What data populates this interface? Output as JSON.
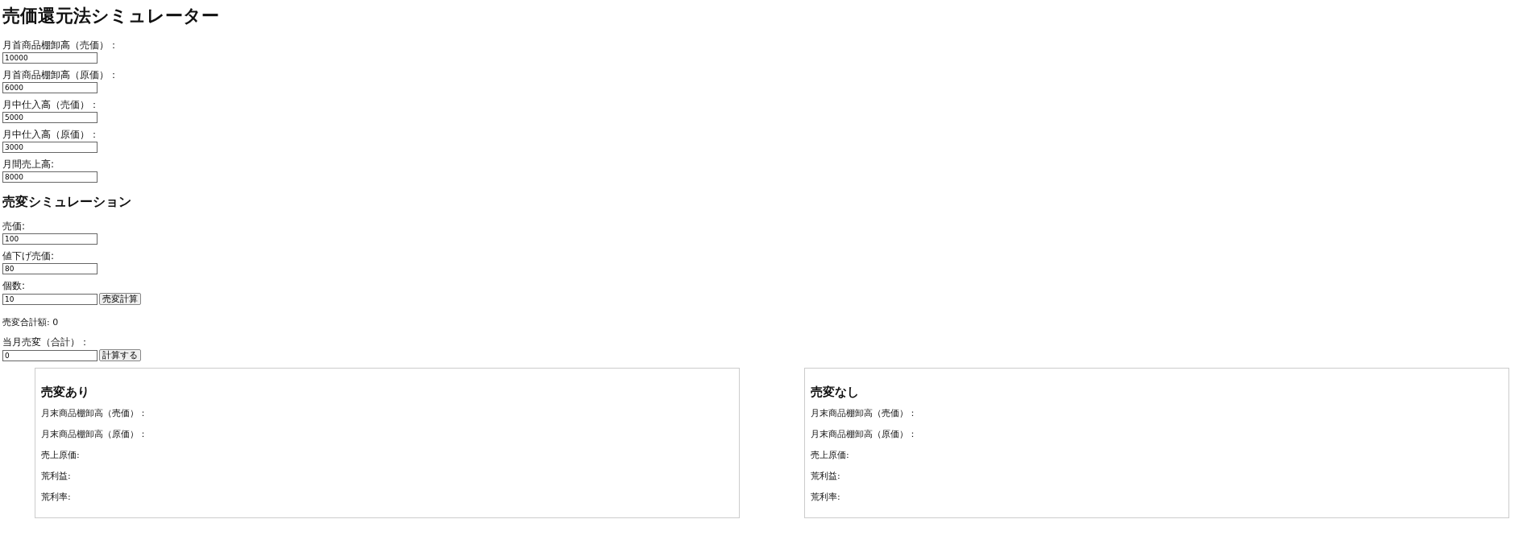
{
  "title": "売価還元法シミュレーター",
  "inputs": [
    {
      "label": "月首商品棚卸高（売価）：",
      "value": "10000"
    },
    {
      "label": "月首商品棚卸高（原価）：",
      "value": "6000"
    },
    {
      "label": "月中仕入高（売価）：",
      "value": "5000"
    },
    {
      "label": "月中仕入高（原価）：",
      "value": "3000"
    },
    {
      "label": "月間売上高:",
      "value": "8000"
    }
  ],
  "simulation": {
    "heading": "売変シミュレーション",
    "fields": [
      {
        "label": "売価:",
        "value": "100"
      },
      {
        "label": "値下げ売価:",
        "value": "80"
      },
      {
        "label": "個数:",
        "value": "10",
        "button": "売変計算"
      }
    ],
    "total": "売変合計額: 0",
    "monthly": {
      "label": "当月売変（合計）：",
      "value": "0",
      "button": "計算する"
    }
  },
  "results": [
    {
      "heading": "売変あり",
      "lines": [
        "月末商品棚卸高（売価）：",
        "月末商品棚卸高（原価）：",
        "売上原価:",
        "荒利益:",
        "荒利率:"
      ]
    },
    {
      "heading": "売変なし",
      "lines": [
        "月末商品棚卸高（売価）：",
        "月末商品棚卸高（原価）：",
        "売上原価:",
        "荒利益:",
        "荒利率:"
      ]
    }
  ]
}
